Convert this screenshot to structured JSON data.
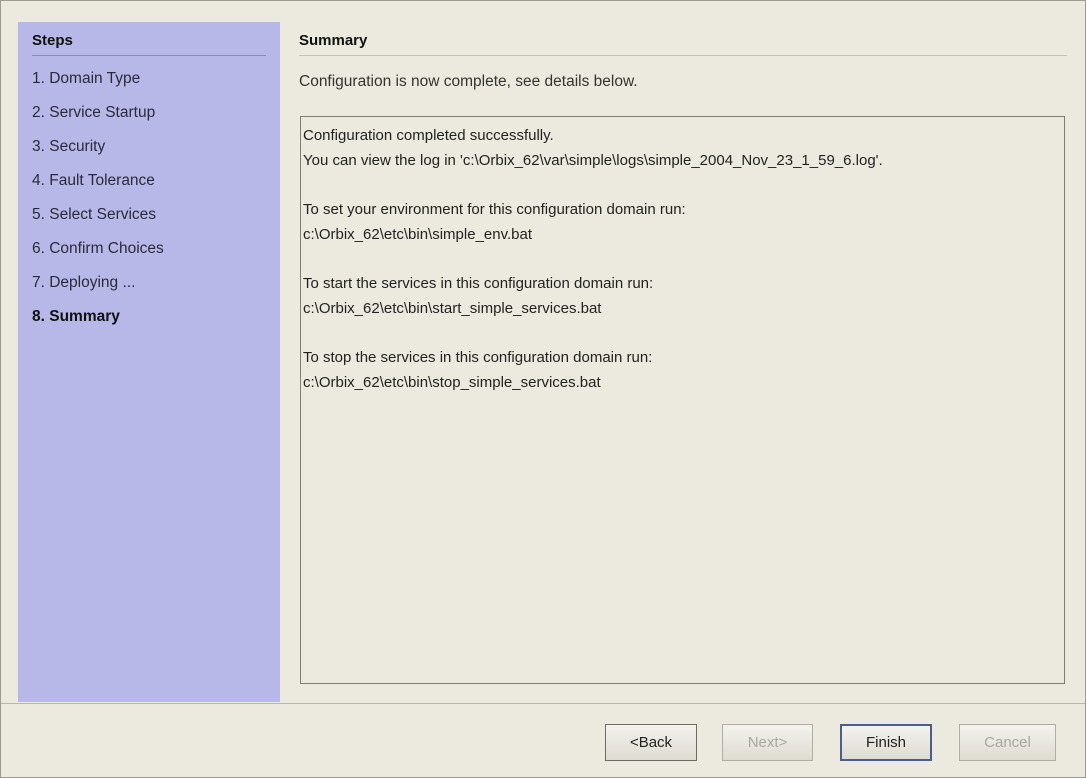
{
  "steps_panel": {
    "title": "Steps",
    "items": [
      {
        "label": "1. Domain Type"
      },
      {
        "label": "2. Service Startup"
      },
      {
        "label": "3. Security"
      },
      {
        "label": "4. Fault Tolerance"
      },
      {
        "label": "5. Select Services"
      },
      {
        "label": "6. Confirm Choices"
      },
      {
        "label": "7. Deploying ..."
      },
      {
        "label": "8. Summary"
      }
    ]
  },
  "summary": {
    "title": "Summary",
    "intro": "Configuration is now complete, see details below.",
    "details": [
      "Configuration completed successfully.",
      "You can view the log in 'c:\\Orbix_62\\var\\simple\\logs\\simple_2004_Nov_23_1_59_6.log'.",
      "",
      "To set your environment for this configuration domain run:",
      "c:\\Orbix_62\\etc\\bin\\simple_env.bat",
      "",
      "To start the services in this configuration domain run:",
      "c:\\Orbix_62\\etc\\bin\\start_simple_services.bat",
      "",
      "To stop the services in this configuration domain run:",
      "c:\\Orbix_62\\etc\\bin\\stop_simple_services.bat"
    ]
  },
  "buttons": {
    "back": "<Back",
    "next": "Next>",
    "finish": "Finish",
    "cancel": "Cancel"
  },
  "colors": {
    "steps_background": "#b8b8e8",
    "window_background": "#ece9df",
    "default_button_border": "#4b5e8c"
  }
}
